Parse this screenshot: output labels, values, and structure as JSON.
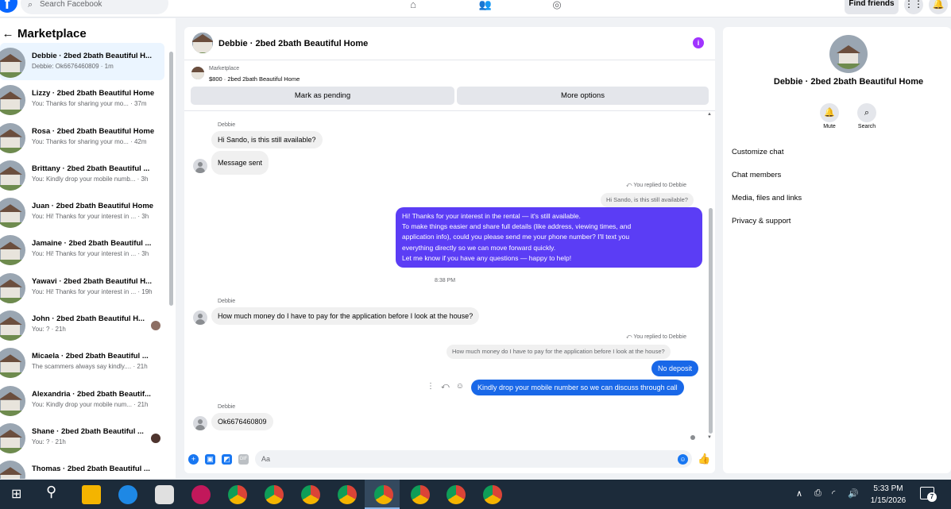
{
  "topnav": {
    "search_placeholder": "Search Facebook",
    "find_friends_label": "Find friends"
  },
  "left": {
    "title": "Marketplace",
    "conversations": [
      {
        "name": "Debbie · 2bed 2bath Beautiful H...",
        "preview": "Debbie: Ok6676460809 · 1m"
      },
      {
        "name": "Lizzy · 2bed 2bath Beautiful Home",
        "preview": "You: Thanks for sharing your mo... · 37m"
      },
      {
        "name": "Rosa · 2bed 2bath Beautiful Home",
        "preview": "You: Thanks for sharing your mo... · 42m"
      },
      {
        "name": "Brittany · 2bed 2bath Beautiful ...",
        "preview": "You: Kindly drop your mobile numb... · 3h"
      },
      {
        "name": "Juan · 2bed 2bath Beautiful Home",
        "preview": "You: Hi! Thanks for your interest in ... · 3h"
      },
      {
        "name": "Jamaine · 2bed 2bath Beautiful ...",
        "preview": "You: Hi! Thanks for your interest in ... · 3h"
      },
      {
        "name": "Yawavi · 2bed 2bath Beautiful H...",
        "preview": "You: Hi! Thanks for your interest in ... · 19h"
      },
      {
        "name": "John · 2bed 2bath Beautiful H...",
        "preview": "You: ? · 21h"
      },
      {
        "name": "Micaela · 2bed 2bath Beautiful ...",
        "preview": "The scammers always say kindly.... · 21h"
      },
      {
        "name": "Alexandria · 2bed 2bath Beautif...",
        "preview": "You: Kindly drop your mobile num... · 21h"
      },
      {
        "name": "Shane · 2bed 2bath Beautiful ...",
        "preview": "You: ? · 21h"
      },
      {
        "name": "Thomas · 2bed 2bath Beautiful ...",
        "preview": ""
      }
    ]
  },
  "chat": {
    "title": "Debbie · 2bed 2bath Beautiful Home",
    "listing_source": "Marketplace",
    "listing_title": "$800 · 2bed 2bath Beautiful Home",
    "mark_pending_label": "Mark as pending",
    "more_options_label": "More options",
    "sender_name": "Debbie",
    "msg1": "Hi Sando, is this still available?",
    "msg2": "Message sent",
    "replied_note": "You replied to Debbie",
    "quote1": "Hi Sando, is this still available?",
    "out_long": [
      "Hi! Thanks for your interest in the rental — it's still available.",
      "To make things easier and share full details (like address, viewing times, and",
      "application info), could you please send me your phone number? I'll text you",
      "everything directly so we can move forward quickly.",
      "Let me know if you have any questions — happy to help!"
    ],
    "timestamp": "8:38 PM",
    "msg3": "How much money do I have to pay for the application before I look at the house?",
    "quote2": "How much money do I have to pay for the application before I look at the house?",
    "out_no_deposit": "No deposit",
    "out_kindly": "Kindly drop your mobile number so we can discuss through call",
    "msg4": "Ok6676460809",
    "composer_placeholder": "Aa"
  },
  "right": {
    "title": "Debbie · 2bed 2bath Beautiful Home",
    "mute_label": "Mute",
    "search_label": "Search",
    "items": [
      "Customize chat",
      "Chat members",
      "Media, files and links",
      "Privacy & support"
    ]
  },
  "taskbar": {
    "time": "5:33 PM",
    "date": "1/15/2026",
    "notification_count": "7"
  },
  "colors": {
    "brand": "#0866ff",
    "outgoing_bubble": "#5b3df5",
    "outgoing_blue": "#1968e8",
    "info_purple": "#a033ff"
  }
}
